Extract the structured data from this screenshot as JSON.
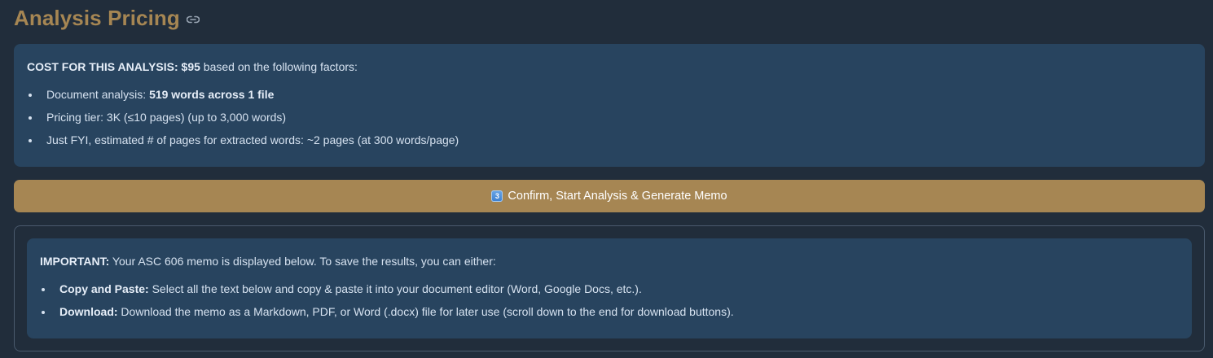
{
  "pricing": {
    "title": "Analysis Pricing",
    "link_icon": "link-icon",
    "cost_label": "COST FOR THIS ANALYSIS:",
    "cost_amount": "$95",
    "cost_suffix": " based on the following factors:",
    "factors": [
      {
        "label": "Document analysis: ",
        "value": "519 words across 1 file"
      },
      {
        "label": "Pricing tier: 3K (≤10 pages) (up to 3,000 words)",
        "value": ""
      },
      {
        "label": "Just FYI, estimated # of pages for extracted words: ~2 pages (at 300 words/page)",
        "value": ""
      }
    ]
  },
  "confirm": {
    "badge": "3",
    "label": "Confirm, Start Analysis & Generate Memo"
  },
  "memo_notice": {
    "important_label": "IMPORTANT:",
    "important_text": " Your ASC 606 memo is displayed below. To save the results, you can either:",
    "options": [
      {
        "label": "Copy and Paste:",
        "text": " Select all the text below and copy & paste it into your document editor (Word, Google Docs, etc.)."
      },
      {
        "label": "Download:",
        "text": " Download the memo as a Markdown, PDF, or Word (.docx) file for later use (scroll down to the end for download buttons)."
      }
    ]
  },
  "colors": {
    "background": "#212d3b",
    "accent": "#a68653",
    "info_box": "#28445f"
  }
}
